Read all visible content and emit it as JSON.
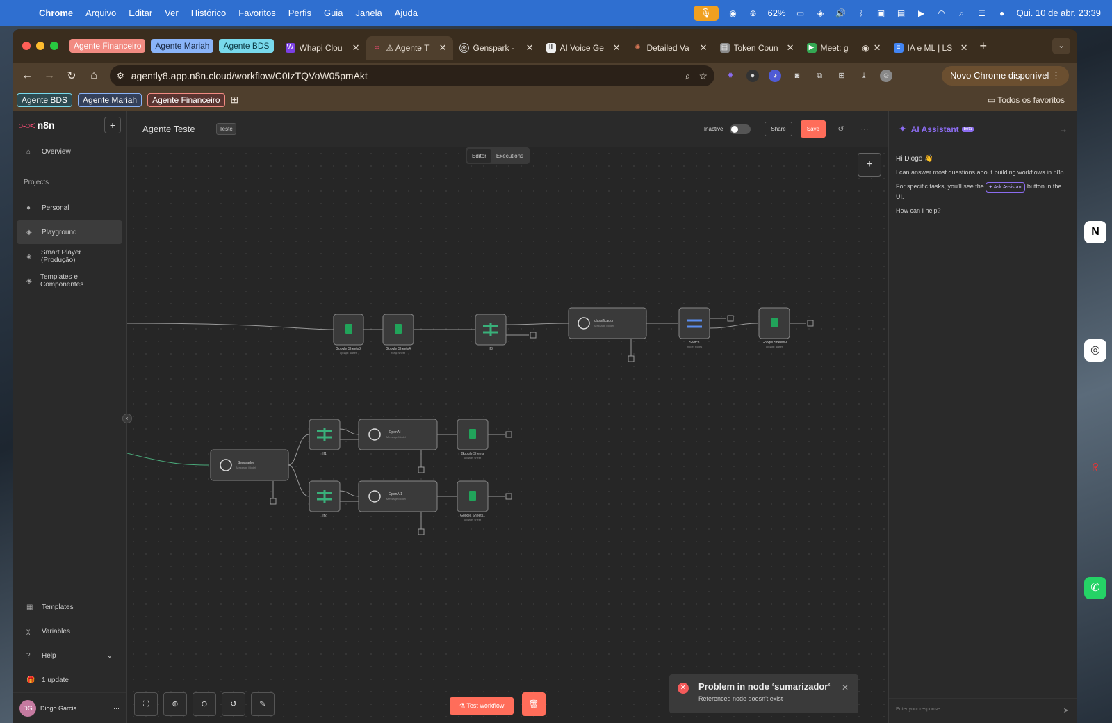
{
  "menubar": {
    "app_name": "Chrome",
    "items": [
      "Arquivo",
      "Editar",
      "Ver",
      "Histórico",
      "Favoritos",
      "Perfis",
      "Guia",
      "Janela",
      "Ajuda"
    ],
    "battery": "62%",
    "datetime": "Qui. 10 de abr.  23:39"
  },
  "tab_groups": [
    {
      "label": "Agente Financeiro",
      "color": "#f28b82"
    },
    {
      "label": "Agente Mariah",
      "color": "#8ab4f8"
    },
    {
      "label": "Agente BDS",
      "color": "#78d9ec"
    }
  ],
  "tabs": [
    {
      "title": "Whapi Clou",
      "icon": "whapi-icon",
      "color": "#7b3fe4"
    },
    {
      "title": "⚠ Agente T",
      "icon": "n8n-icon",
      "color": "#ea4b71",
      "active": true
    },
    {
      "title": "Genspark -",
      "icon": "genspark-icon",
      "color": "#555"
    },
    {
      "title": "AI Voice Ge",
      "icon": "elevenlabs-icon",
      "color": "#eee"
    },
    {
      "title": "Detailed Va",
      "icon": "claude-icon",
      "color": "#d97757"
    },
    {
      "title": "Token Coun",
      "icon": "doc-icon",
      "color": "#8a8a8a"
    },
    {
      "title": "Meet: g",
      "icon": "meet-icon",
      "color": "#34a853"
    },
    {
      "title": "IA e ML | LS",
      "icon": "docs-icon",
      "color": "#4285f4"
    }
  ],
  "url": "agently8.app.n8n.cloud/workflow/C0IzTQVoW05pmAkt",
  "update_button": "Novo Chrome disponível",
  "bookmarks": [
    {
      "label": "Agente BDS",
      "color": "#78d9ec"
    },
    {
      "label": "Agente Mariah",
      "color": "#8ab4f8"
    },
    {
      "label": "Agente Financeiro",
      "color": "#f28b82"
    }
  ],
  "all_bookmarks": "Todos os favoritos",
  "sidebar": {
    "brand": "n8n",
    "overview": "Overview",
    "projects_label": "Projects",
    "projects": [
      "Personal",
      "Playground",
      "Smart Player (Produção)",
      "Templates e Componentes"
    ],
    "active_project": "Playground",
    "templates": "Templates",
    "variables": "Variables",
    "help": "Help",
    "update": "1 update",
    "user_name": "Diogo Garcia",
    "user_initials": "DG"
  },
  "workflow": {
    "name": "Agente Teste",
    "tag": "Teste",
    "status": "Inactive",
    "share": "Share",
    "save": "Save",
    "tab_editor": "Editor",
    "tab_executions": "Executions",
    "test_button": "Test workflow"
  },
  "toast": {
    "title": "Problem in node ‘sumarizador‘",
    "message": "Referenced node doesn't exist"
  },
  "assistant": {
    "title": "AI Assistant",
    "badge": "beta",
    "greeting": "Hi Diogo 👋",
    "line1": "I can answer most questions about building workflows in n8n.",
    "line2_pre": "For specific tasks, you'll see the",
    "ask_button": "✦ Ask Assistant",
    "line2_post": "button in the UI.",
    "line3": "How can I help?",
    "input_placeholder": "Enter your response..."
  },
  "nodes": [
    {
      "id": "gs8",
      "label": "Google Sheets8",
      "sub": "update: sheet",
      "type": "sheets"
    },
    {
      "id": "gs4",
      "label": "Google Sheets4",
      "sub": "read: sheet",
      "type": "sheets"
    },
    {
      "id": "if3",
      "label": "If3",
      "sub": "",
      "type": "if"
    },
    {
      "id": "class",
      "label": "classificador",
      "sub": "Message Model",
      "type": "openai"
    },
    {
      "id": "switch",
      "label": "Switch",
      "sub": "mode: Rules",
      "type": "switch"
    },
    {
      "id": "gs9",
      "label": "Google Sheets9",
      "sub": "update: sheet",
      "type": "sheets"
    },
    {
      "id": "sep",
      "label": "Separador",
      "sub": "Message Model",
      "type": "openai"
    },
    {
      "id": "if1",
      "label": "If1",
      "sub": "",
      "type": "if"
    },
    {
      "id": "openai",
      "label": "OpenAI",
      "sub": "Message Model",
      "type": "openai"
    },
    {
      "id": "gs",
      "label": "Google Sheets",
      "sub": "update: sheet",
      "type": "sheets"
    },
    {
      "id": "if2",
      "label": "If2",
      "sub": "",
      "type": "if"
    },
    {
      "id": "openai1",
      "label": "OpenAI1",
      "sub": "Message Model",
      "type": "openai"
    },
    {
      "id": "gs1",
      "label": "Google Sheets1",
      "sub": "update: sheet",
      "type": "sheets"
    }
  ]
}
